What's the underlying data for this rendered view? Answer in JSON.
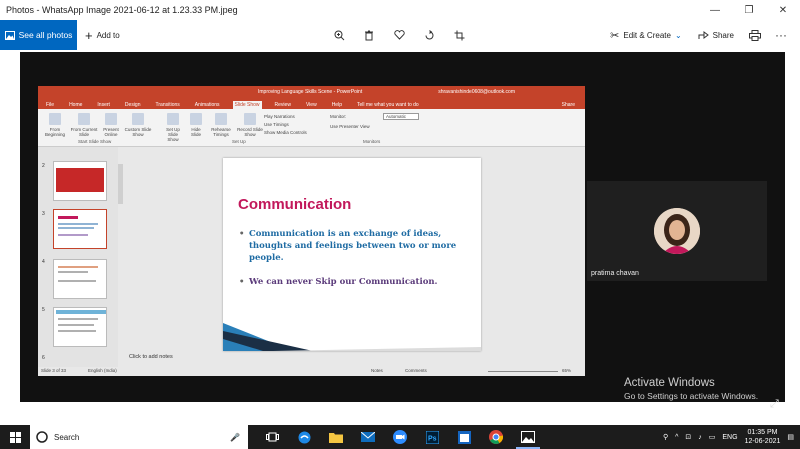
{
  "window": {
    "title": "Photos - WhatsApp Image 2021-06-12 at 1.23.33 PM.jpeg",
    "controls": {
      "minimize": "—",
      "maximize": "❐",
      "close": "✕"
    }
  },
  "toolbar": {
    "see_all_photos": "See all photos",
    "add_to": "Add to",
    "edit_create": "Edit & Create",
    "share": "Share",
    "more": "···"
  },
  "ppt": {
    "title": "Improving Language Skills  Scene  -  PowerPoint",
    "account": "shravanishinde0608@outlook.com",
    "share": "Share",
    "tabs": [
      "File",
      "Home",
      "Insert",
      "Design",
      "Transitions",
      "Animations",
      "Slide Show",
      "Review",
      "View",
      "Help",
      "Tell me what you want to do"
    ],
    "active_tab": "Slide Show",
    "ribbon": {
      "from_beginning": "From Beginning",
      "from_current": "From Current Slide",
      "present_online": "Present Online",
      "custom_slide_show": "Custom Slide Show",
      "set_up": "Set Up Slide Show",
      "hide_slide": "Hide Slide",
      "rehearse": "Rehearse Timings",
      "record": "Record Slide Show",
      "play_narrations": "Play Narrations",
      "use_timings": "Use Timings",
      "show_media_controls": "Show Media Controls",
      "monitor_label": "Monitor:",
      "monitor_value": "Automatic",
      "use_presenter_view": "Use Presenter View",
      "group_start": "Start Slide Show",
      "group_setup": "Set Up",
      "group_monitors": "Monitors"
    },
    "thumb_numbers": [
      "2",
      "3",
      "4",
      "5",
      "6"
    ],
    "slide": {
      "title": "Communication",
      "bullet1": "Communication is an exchange of ideas, thoughts and feelings between two or more people.",
      "bullet2": "We can never Skip our Communication."
    },
    "notes_placeholder": "Click to add notes",
    "status": {
      "slide_of": "Slide 3 of 33",
      "language": "English (India)",
      "notes": "Notes",
      "comments": "Comments",
      "zoom": "65%"
    }
  },
  "participant": {
    "name": "pratima chavan"
  },
  "watermark": {
    "line1": "Activate Windows",
    "line2": "Go to Settings to activate Windows."
  },
  "taskbar": {
    "search_placeholder": "Search",
    "lang": "ENG",
    "time": "01:35 PM",
    "date": "12-06-2021"
  },
  "colors": {
    "accent": "#0067c0",
    "ppt_red": "#c4432a",
    "slide_title": "#c2185b",
    "slide_text": "#1e6ba3"
  }
}
